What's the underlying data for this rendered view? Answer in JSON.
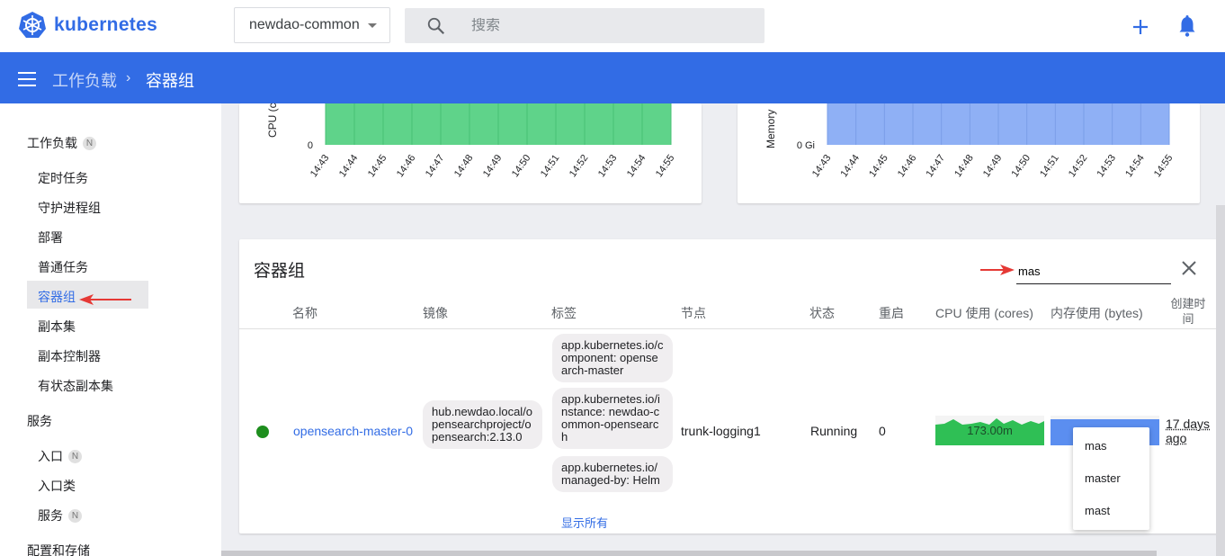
{
  "app": {
    "name": "kubernetes"
  },
  "namespace": {
    "selected": "newdao-common"
  },
  "search": {
    "placeholder": "搜索"
  },
  "breadcrumb": {
    "parent": "工作负载",
    "separator": "›",
    "current": "容器组"
  },
  "sidebar": {
    "workloads": {
      "label": "工作负载",
      "badge": "N"
    },
    "items": [
      "定时任务",
      "守护进程组",
      "部署",
      "普通任务",
      "容器组",
      "副本集",
      "副本控制器",
      "有状态副本集"
    ],
    "active_index": 4,
    "services": {
      "label": "服务"
    },
    "service_items": [
      {
        "label": "入口",
        "badge": "N"
      },
      {
        "label": "入口类",
        "badge": ""
      },
      {
        "label": "服务",
        "badge": "N"
      }
    ],
    "config": {
      "label": "配置和存储"
    }
  },
  "cpu_chart": {
    "axis_title": "CPU (c",
    "zero_label": "0",
    "times": [
      "14:43",
      "14:44",
      "14:45",
      "14:46",
      "14:47",
      "14:48",
      "14:49",
      "14:50",
      "14:51",
      "14:52",
      "14:53",
      "14:54",
      "14:55"
    ],
    "color": "#5fd38a"
  },
  "mem_chart": {
    "axis_title": "Memory",
    "zero_label": "0 Gi",
    "times": [
      "14:43",
      "14:44",
      "14:45",
      "14:46",
      "14:47",
      "14:48",
      "14:49",
      "14:50",
      "14:51",
      "14:52",
      "14:53",
      "14:54",
      "14:55"
    ],
    "color": "#8fb0f5"
  },
  "pods": {
    "title": "容器组",
    "filter_value": "mas",
    "columns": [
      "名称",
      "镜像",
      "标签",
      "节点",
      "状态",
      "重启",
      "CPU 使用 (cores)",
      "内存使用 (bytes)",
      "创建时间"
    ],
    "row": {
      "name": "opensearch-master-0",
      "image": "hub.newdao.local/opensearchproject/opensearch:2.13.0",
      "labels": [
        "app.kubernetes.io/component: opensearch-master",
        "app.kubernetes.io/instance: newdao-common-opensearch",
        "app.kubernetes.io/managed-by: Helm"
      ],
      "show_all": "显示所有",
      "node": "trunk-logging1",
      "status": "Running",
      "restarts": "0",
      "cpu": "173.00m",
      "created": "17 days ago"
    }
  },
  "autocomplete": [
    "mas",
    "master",
    "mast"
  ],
  "colors": {
    "accent": "#326ce5",
    "annotation_arrow": "#e53935",
    "running": "#1e8e1e"
  }
}
